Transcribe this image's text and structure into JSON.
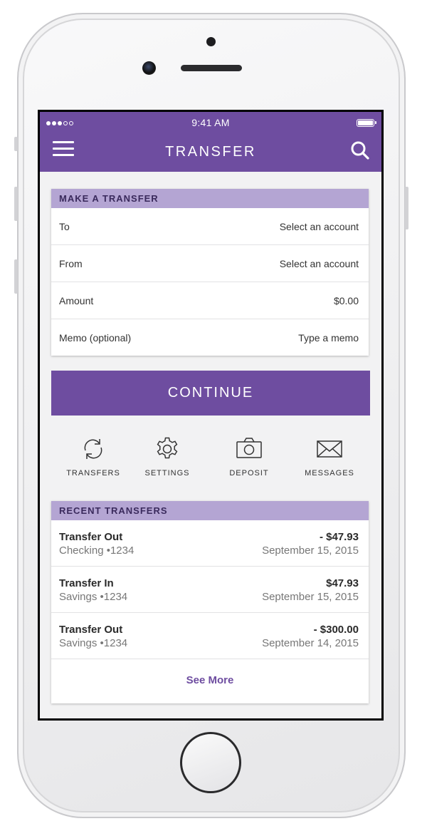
{
  "status_bar": {
    "time": "9:41 AM",
    "signal": "signal-dots",
    "battery": "battery-full"
  },
  "header": {
    "title": "TRANSFER",
    "menu_icon": "hamburger-menu-icon",
    "search_icon": "search-icon"
  },
  "make_transfer": {
    "heading": "MAKE A TRANSFER",
    "rows": [
      {
        "label": "To",
        "value": "Select an account"
      },
      {
        "label": "From",
        "value": "Select an account"
      },
      {
        "label": "Amount",
        "value": "$0.00"
      },
      {
        "label": "Memo (optional)",
        "value": "Type a memo"
      }
    ]
  },
  "continue_label": "CONTINUE",
  "quick_actions": [
    {
      "label": "TRANSFERS",
      "icon": "refresh-icon"
    },
    {
      "label": "SETTINGS",
      "icon": "gear-icon"
    },
    {
      "label": "DEPOSIT",
      "icon": "camera-icon"
    },
    {
      "label": "MESSAGES",
      "icon": "envelope-icon"
    }
  ],
  "recent_transfers": {
    "heading": "RECENT TRANSFERS",
    "items": [
      {
        "name": "Transfer Out",
        "account": "Checking •1234",
        "amount": "- $47.93",
        "date": "September 15, 2015"
      },
      {
        "name": "Transfer In",
        "account": "Savings •1234",
        "amount": "$47.93",
        "date": "September 15, 2015"
      },
      {
        "name": "Transfer Out",
        "account": "Savings •1234",
        "amount": "- $300.00",
        "date": "September 14, 2015"
      }
    ],
    "see_more": "See More"
  },
  "colors": {
    "brand": "#6e4da0",
    "header_light": "#b4a5d3",
    "background": "#f2f2f3"
  }
}
